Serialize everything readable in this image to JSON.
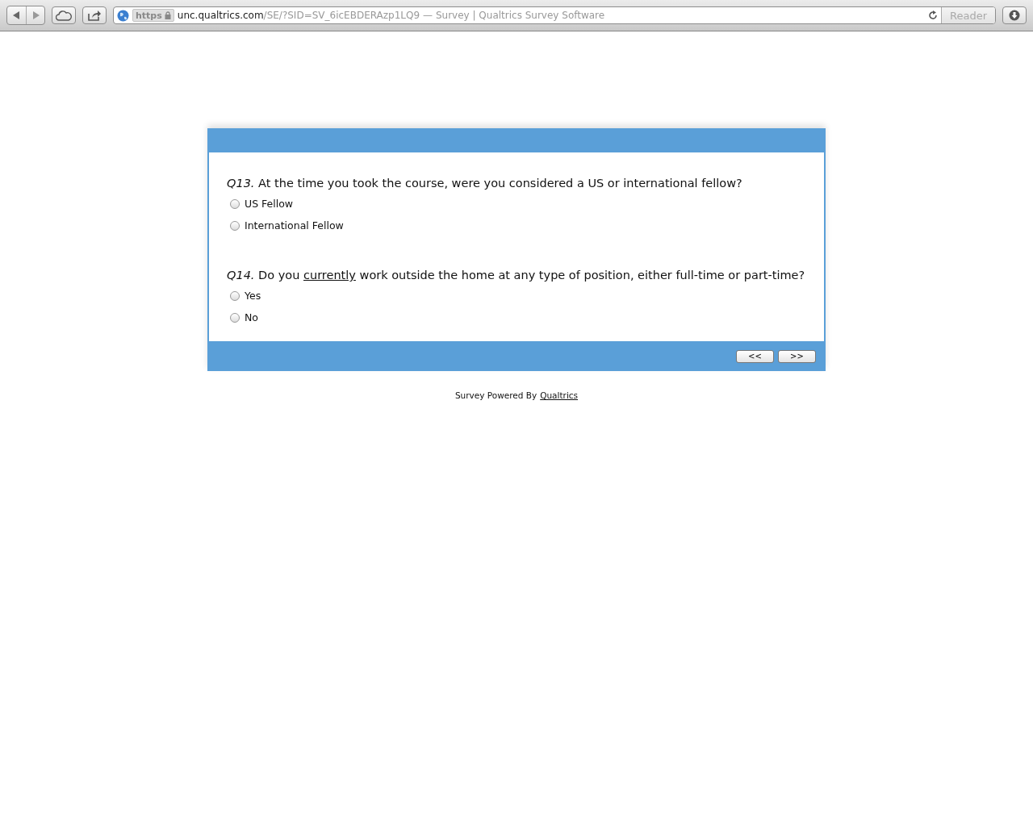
{
  "browser": {
    "https_label": "https",
    "url_host": "unc.qualtrics.com",
    "url_path": "/SE/?SID=SV_6icEBDERAzp1LQ9",
    "page_title": "— Survey | Qualtrics Survey Software",
    "reader_label": "Reader",
    "reader_disabled": true
  },
  "questions": [
    {
      "number": "Q13.",
      "segments": [
        {
          "text": "At the time you took the course, were you considered a US or international fellow?",
          "underline": false
        }
      ],
      "options": [
        {
          "label": "US Fellow",
          "selected": false
        },
        {
          "label": "International Fellow",
          "selected": false
        }
      ]
    },
    {
      "number": "Q14.",
      "segments": [
        {
          "text": "Do you ",
          "underline": false
        },
        {
          "text": "currently",
          "underline": true
        },
        {
          "text": " work outside the home at any type of position, either full-time or part-time?",
          "underline": false
        }
      ],
      "options": [
        {
          "label": "Yes",
          "selected": false
        },
        {
          "label": "No",
          "selected": false
        }
      ]
    }
  ],
  "nav_buttons": [
    "<<",
    ">>"
  ],
  "footer": {
    "text": "Survey Powered By",
    "link": "Qualtrics"
  }
}
